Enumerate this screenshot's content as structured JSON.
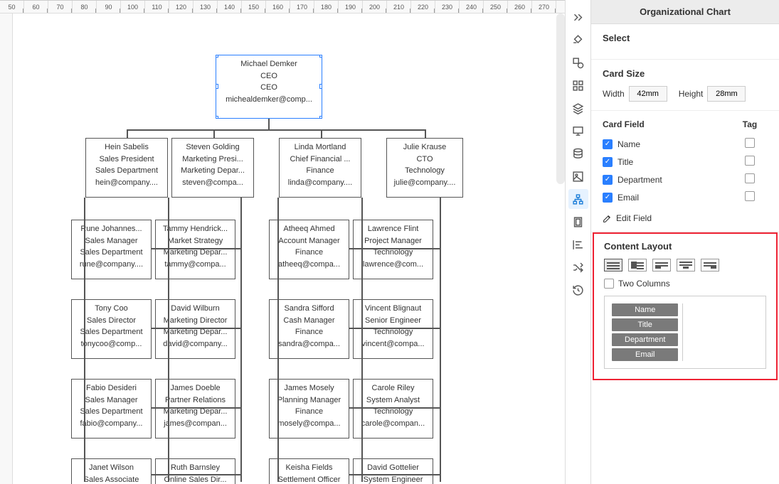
{
  "ruler_ticks": [
    "50",
    "60",
    "70",
    "80",
    "90",
    "100",
    "110",
    "120",
    "130",
    "140",
    "150",
    "160",
    "170",
    "180",
    "190",
    "200",
    "210",
    "220",
    "230",
    "240",
    "250",
    "260",
    "270"
  ],
  "selected_node": {
    "name": "Michael Demker",
    "title": "CEO",
    "department": "CEO",
    "email": "michealdemker@comp..."
  },
  "level2": [
    {
      "name": "Hein Sabelis",
      "title": "Sales President",
      "department": "Sales Department",
      "email": "hein@company...."
    },
    {
      "name": "Steven Golding",
      "title": "Marketing Presi...",
      "department": "Marketing Depar...",
      "email": "steven@compa..."
    },
    {
      "name": "Linda Mortland",
      "title": "Chief Financial ...",
      "department": "Finance",
      "email": "linda@company...."
    },
    {
      "name": "Julie Krause",
      "title": "CTO",
      "department": "Technology",
      "email": "julie@company...."
    }
  ],
  "columns": [
    [
      {
        "name": "Rune Johannes...",
        "title": "Sales Manager",
        "department": "Sales Department",
        "email": "rune@company...."
      },
      {
        "name": "Tony Coo",
        "title": "Sales Director",
        "department": "Sales Department",
        "email": "tonycoo@comp..."
      },
      {
        "name": "Fabio Desideri",
        "title": "Sales Manager",
        "department": "Sales Department",
        "email": "fabio@company..."
      },
      {
        "name": "Janet Wilson",
        "title": "Sales Associate",
        "department": "",
        "email": ""
      }
    ],
    [
      {
        "name": "Tammy Hendrick...",
        "title": "Market Strategy",
        "department": "Marketing Depar...",
        "email": "tammy@compa..."
      },
      {
        "name": "David Wilburn",
        "title": "Marketing Director",
        "department": "Marketing Depar...",
        "email": "david@company..."
      },
      {
        "name": "James Doeble",
        "title": "Partner Relations",
        "department": "Marketing Depar...",
        "email": "james@compan..."
      },
      {
        "name": "Ruth Barnsley",
        "title": "Online Sales Dir...",
        "department": "",
        "email": ""
      }
    ],
    [
      {
        "name": "Atheeq Ahmed",
        "title": "Account Manager",
        "department": "Finance",
        "email": "atheeq@compa..."
      },
      {
        "name": "Sandra Sifford",
        "title": "Cash Manager",
        "department": "Finance",
        "email": "sandra@compa..."
      },
      {
        "name": "James Mosely",
        "title": "Planning Manager",
        "department": "Finance",
        "email": "mosely@compa..."
      },
      {
        "name": "Keisha Fields",
        "title": "Settlement Officer",
        "department": "",
        "email": ""
      }
    ],
    [
      {
        "name": "Lawrence Flint",
        "title": "Project Manager",
        "department": "Technology",
        "email": "lawrence@com..."
      },
      {
        "name": "Vincent Blignaut",
        "title": "Senior Engineer",
        "department": "Technology",
        "email": "vincent@compa..."
      },
      {
        "name": "Carole Riley",
        "title": "System Analyst",
        "department": "Technology",
        "email": "carole@compan..."
      },
      {
        "name": "David Gottelier",
        "title": "System Engineer",
        "department": "",
        "email": ""
      }
    ]
  ],
  "panel": {
    "title": "Organizational Chart",
    "select_label": "Select",
    "card_size_label": "Card Size",
    "width_label": "Width",
    "width_value": "42mm",
    "height_label": "Height",
    "height_value": "28mm",
    "card_field_label": "Card Field",
    "tag_label": "Tag",
    "fields": [
      {
        "label": "Name",
        "checked": true,
        "tag": false
      },
      {
        "label": "Title",
        "checked": true,
        "tag": false
      },
      {
        "label": "Department",
        "checked": true,
        "tag": false
      },
      {
        "label": "Email",
        "checked": true,
        "tag": false
      }
    ],
    "edit_field": "Edit Field",
    "content_layout": "Content Layout",
    "two_columns": "Two Columns",
    "preview_fields": [
      "Name",
      "Title",
      "Department",
      "Email"
    ]
  }
}
